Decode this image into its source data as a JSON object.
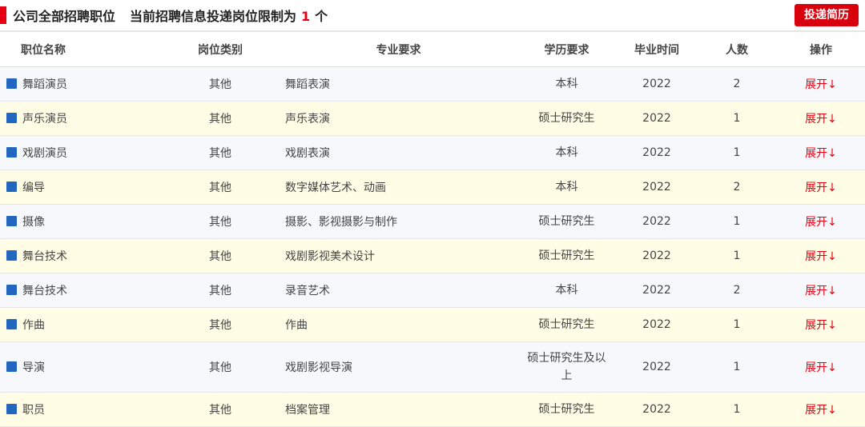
{
  "header": {
    "title": "公司全部招聘职位",
    "limit_prefix": "当前招聘信息投递岗位限制为",
    "limit_count": "1",
    "limit_suffix": "个",
    "submit_button": "投递简历"
  },
  "table": {
    "columns": [
      "职位名称",
      "岗位类别",
      "专业要求",
      "学历要求",
      "毕业时间",
      "人数",
      "操作"
    ],
    "rows": [
      {
        "name": "舞蹈演员",
        "category": "其他",
        "major": "舞蹈表演",
        "education": "本科",
        "year": "2022",
        "count": "2",
        "action": "展开↓"
      },
      {
        "name": "声乐演员",
        "category": "其他",
        "major": "声乐表演",
        "education": "硕士研究生",
        "year": "2022",
        "count": "1",
        "action": "展开↓"
      },
      {
        "name": "戏剧演员",
        "category": "其他",
        "major": "戏剧表演",
        "education": "本科",
        "year": "2022",
        "count": "1",
        "action": "展开↓"
      },
      {
        "name": "编导",
        "category": "其他",
        "major": "数字媒体艺术、动画",
        "education": "本科",
        "year": "2022",
        "count": "2",
        "action": "展开↓"
      },
      {
        "name": "摄像",
        "category": "其他",
        "major": "摄影、影视摄影与制作",
        "education": "硕士研究生",
        "year": "2022",
        "count": "1",
        "action": "展开↓"
      },
      {
        "name": "舞台技术",
        "category": "其他",
        "major": "戏剧影视美术设计",
        "education": "硕士研究生",
        "year": "2022",
        "count": "1",
        "action": "展开↓"
      },
      {
        "name": "舞台技术",
        "category": "其他",
        "major": "录音艺术",
        "education": "本科",
        "year": "2022",
        "count": "2",
        "action": "展开↓"
      },
      {
        "name": "作曲",
        "category": "其他",
        "major": "作曲",
        "education": "硕士研究生",
        "year": "2022",
        "count": "1",
        "action": "展开↓"
      },
      {
        "name": "导演",
        "category": "其他",
        "major": "戏剧影视导演",
        "education": "硕士研究生及以上",
        "year": "2022",
        "count": "1",
        "action": "展开↓"
      },
      {
        "name": "职员",
        "category": "其他",
        "major": "档案管理",
        "education": "硕士研究生",
        "year": "2022",
        "count": "1",
        "action": "展开↓"
      }
    ]
  },
  "colors": {
    "accent": "#e60012",
    "row_odd": "#f7f8fc",
    "row_even": "#fffde6",
    "square_icon": "#2266c0"
  },
  "icons": {
    "row_marker": "square-icon"
  }
}
